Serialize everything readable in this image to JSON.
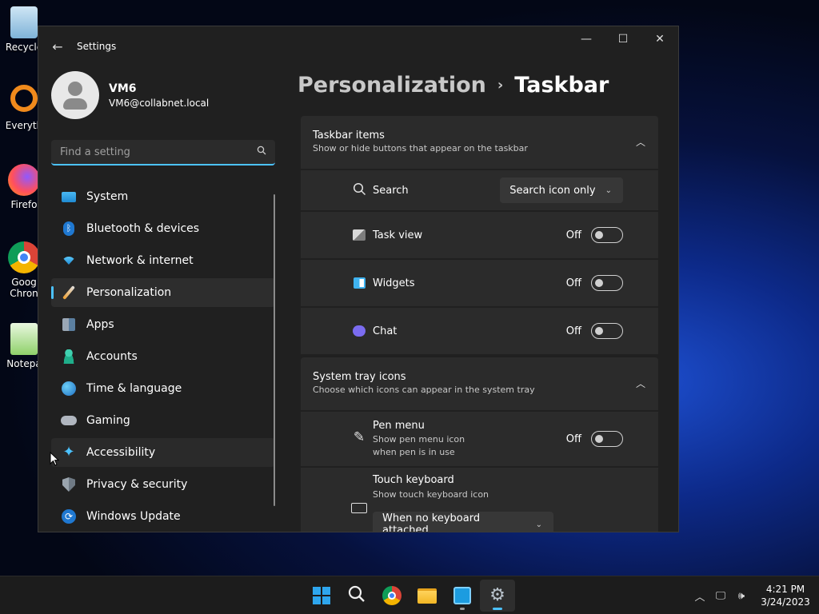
{
  "desktop": {
    "icons": [
      {
        "label": "Recycle",
        "icon": "recycle-bin-icon"
      },
      {
        "label": "Everyth",
        "icon": "everything-search-icon"
      },
      {
        "label": "Firefo",
        "icon": "firefox-icon"
      },
      {
        "label": "Goog Chron",
        "label2": "Chron",
        "label1": "Goog",
        "icon": "chrome-icon"
      },
      {
        "label": "Notepa",
        "icon": "notepad-icon"
      }
    ]
  },
  "window": {
    "title": "Settings",
    "controls": {
      "minimize": "—",
      "maximize": "☐",
      "close": "✕"
    }
  },
  "profile": {
    "name": "VM6",
    "email": "VM6@collabnet.local"
  },
  "search": {
    "placeholder": "Find a setting"
  },
  "nav": [
    {
      "label": "System",
      "icon": "system-icon"
    },
    {
      "label": "Bluetooth & devices",
      "icon": "bluetooth-icon"
    },
    {
      "label": "Network & internet",
      "icon": "wifi-icon"
    },
    {
      "label": "Personalization",
      "icon": "brush-icon"
    },
    {
      "label": "Apps",
      "icon": "apps-icon"
    },
    {
      "label": "Accounts",
      "icon": "accounts-icon"
    },
    {
      "label": "Time & language",
      "icon": "globe-clock-icon"
    },
    {
      "label": "Gaming",
      "icon": "gamepad-icon"
    },
    {
      "label": "Accessibility",
      "icon": "accessibility-icon"
    },
    {
      "label": "Privacy & security",
      "icon": "shield-icon"
    },
    {
      "label": "Windows Update",
      "icon": "update-icon"
    }
  ],
  "breadcrumb": {
    "parent": "Personalization",
    "separator": "›",
    "current": "Taskbar"
  },
  "taskbar_items": {
    "title": "Taskbar items",
    "subtitle": "Show or hide buttons that appear on the taskbar",
    "rows": [
      {
        "label": "Search",
        "icon": "search-icon",
        "value": "Search icon only"
      },
      {
        "label": "Task view",
        "icon": "task-view-icon",
        "state": "Off"
      },
      {
        "label": "Widgets",
        "icon": "widgets-icon",
        "state": "Off"
      },
      {
        "label": "Chat",
        "icon": "chat-icon",
        "state": "Off"
      }
    ]
  },
  "system_tray": {
    "title": "System tray icons",
    "subtitle": "Choose which icons can appear in the system tray",
    "pen_menu": {
      "label": "Pen menu",
      "desc1": "Show pen menu icon",
      "desc2": "when pen is in use",
      "state": "Off"
    },
    "touch_keyboard": {
      "label": "Touch keyboard",
      "desc": "Show touch keyboard icon",
      "value": "When no keyboard attached"
    }
  },
  "clock": {
    "time": "4:21 PM",
    "date": "3/24/2023"
  },
  "colors": {
    "accent": "#4cc2ff",
    "window_bg": "#202020",
    "card_bg": "#2b2b2b"
  }
}
